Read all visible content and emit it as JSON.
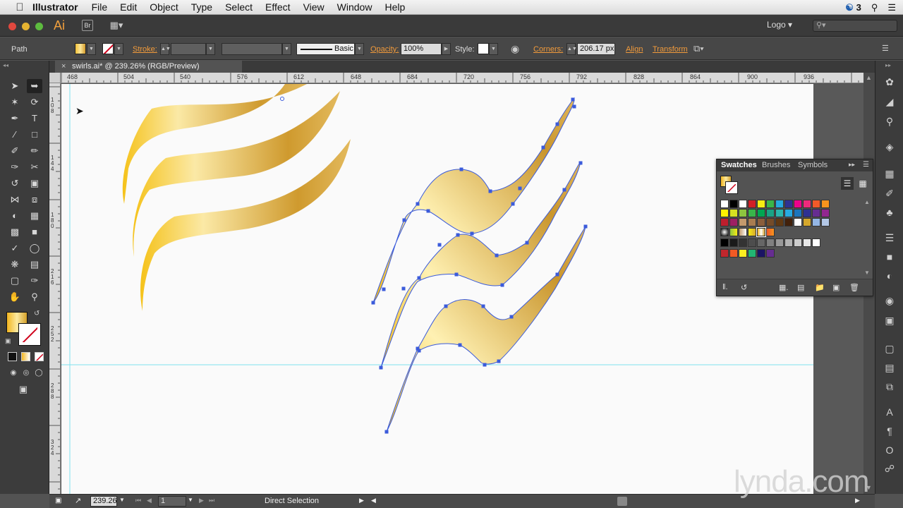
{
  "menubar": {
    "app_name": "Illustrator",
    "items": [
      "File",
      "Edit",
      "Object",
      "Type",
      "Select",
      "Effect",
      "View",
      "Window",
      "Help"
    ],
    "cc_count": "3"
  },
  "appbar": {
    "logo": "Ai",
    "bridge": "Br",
    "workspace": "Logo"
  },
  "control": {
    "selection_type": "Path",
    "stroke_label": "Stroke:",
    "stroke_profile": "Basic",
    "opacity_label": "Opacity:",
    "opacity_value": "100%",
    "style_label": "Style:",
    "corners_label": "Corners:",
    "corners_value": "206.17 px",
    "align_label": "Align",
    "transform_label": "Transform"
  },
  "document": {
    "tab_title": "swirls.ai* @ 239.26% (RGB/Preview)"
  },
  "ruler": {
    "h_ticks": [
      "468",
      "504",
      "540",
      "576",
      "612",
      "648",
      "684",
      "720",
      "756",
      "792",
      "828",
      "864",
      "900",
      "936"
    ],
    "v_ticks": [
      "108",
      "144",
      "180",
      "216",
      "252",
      "288",
      "324"
    ]
  },
  "status": {
    "zoom": "239.26",
    "artboard": "1",
    "tool": "Direct Selection"
  },
  "swatches_panel": {
    "tabs": [
      "Swatches",
      "Brushes",
      "Symbols"
    ],
    "row1": [
      "#ffffff",
      "#000000",
      "#ffffff",
      "#d21f26",
      "#f7ec13",
      "#3ab54a",
      "#26a9e0",
      "#2e3192",
      "#ec008c",
      "#ee2a7b",
      "#f15a29",
      "#f7941d"
    ],
    "row2": [
      "#fff200",
      "#d7e021",
      "#8dc63f",
      "#39b54a",
      "#00a651",
      "#1aa385",
      "#2bb6ad",
      "#27aae1",
      "#1c75bc",
      "#2e3192",
      "#662d91",
      "#92278f"
    ],
    "row3": [
      "#be1e2d",
      "#9e1f63",
      "#c49a6c",
      "#a97c50",
      "#8b5e3c",
      "#754c29",
      "#603913",
      "#42210b",
      "#ffffff",
      "#d4a72c",
      "#94b6e4",
      "#b3c7e6"
    ],
    "row5": [
      "#000000",
      "#1a1a1a",
      "#333333",
      "#4d4d4d",
      "#666666",
      "#808080",
      "#999999",
      "#b3b3b3",
      "#cccccc",
      "#e6e6e6",
      "#ffffff"
    ],
    "row6": [
      "#c1272d",
      "#f15a24",
      "#fcee21",
      "#22b573",
      "#1b1464",
      "#662d91"
    ]
  },
  "watermark": "lynda.com"
}
